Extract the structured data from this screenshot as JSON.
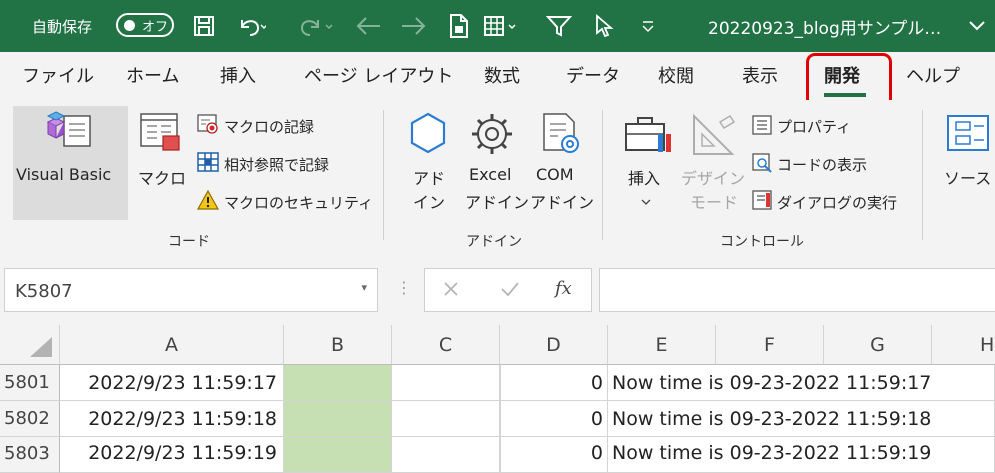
{
  "titlebar": {
    "autosave_label": "自動保存",
    "toggle_text": "オフ",
    "doc_title": "20220923_blog用サンプル…",
    "bg_color": "#217346"
  },
  "tabs": [
    "ファイル",
    "ホーム",
    "挿入",
    "ページ レイアウト",
    "数式",
    "データ",
    "校閲",
    "表示",
    "開発",
    "ヘルプ"
  ],
  "active_tab": "開発",
  "ribbon": {
    "code_group": {
      "label": "コード",
      "visual_basic": "Visual Basic",
      "macro": "マクロ",
      "record_macro": "マクロの記録",
      "relative_ref": "相対参照で記録",
      "macro_security": "マクロのセキュリティ"
    },
    "addins_group": {
      "label": "アドイン",
      "addins_line1": "アド",
      "addins_line2": "イン",
      "excel_line1": "Excel",
      "excel_line2": "アドイン",
      "com_line1": "COM",
      "com_line2": "アドイン"
    },
    "controls_group": {
      "label": "コントロール",
      "insert": "挿入",
      "design_line1": "デザイン",
      "design_line2": "モード",
      "properties": "プロパティ",
      "view_code": "コードの表示",
      "run_dialog": "ダイアログの実行"
    },
    "source": "ソース"
  },
  "formula_bar": {
    "name_box": "K5807",
    "fx": "fx",
    "formula": ""
  },
  "columns": [
    "A",
    "B",
    "C",
    "D",
    "E",
    "F",
    "G",
    "H"
  ],
  "rows": [
    {
      "num": "5801",
      "a": "2022/9/23 11:59:17",
      "d": "0",
      "e": "Now time is 09-23-2022 11:59:17"
    },
    {
      "num": "5802",
      "a": "2022/9/23 11:59:18",
      "d": "0",
      "e": "Now time is 09-23-2022 11:59:18"
    },
    {
      "num": "5803",
      "a": "2022/9/23 11:59:19",
      "d": "0",
      "e": "Now time is 09-23-2022 11:59:19"
    }
  ],
  "colors": {
    "highlight": "#e00000",
    "column_b_fill": "#c6e0b4"
  }
}
